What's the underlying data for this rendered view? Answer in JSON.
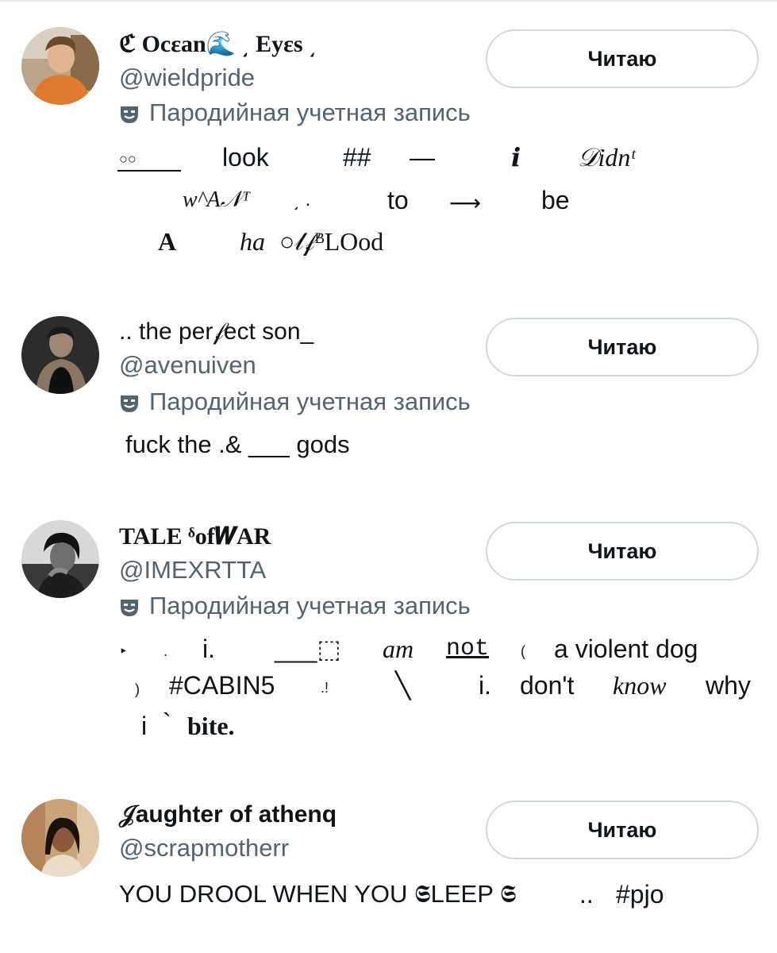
{
  "follow_label": "Читаю",
  "parody_label": "Пародийная учетная запись",
  "accounts": [
    {
      "name": "ℭ Ocεan🌊 ͵ Eyεs ͵",
      "handle": "@wieldpride",
      "bio": [
        "○○",
        "look",
        "##",
        "—",
        "𝒊",
        "𝒟idnᵗ",
        "w^A𝒩ᵀ",
        "͵ .",
        "to",
        "⟶",
        "be",
        "A",
        "ha",
        "○𝓁𝒻ᴮLOod"
      ]
    },
    {
      "name": ".. the per𝒻ect son_",
      "handle": "@avenuiven",
      "bio": [
        "fuck the .& ___ gods"
      ]
    },
    {
      "name": "TALE   ᵟof𝑾AR",
      "handle": "@IMEXRTTA",
      "bio": [
        "‣",
        ".",
        "i.",
        "___⬚",
        "am",
        "not",
        "(",
        "a violent dog",
        ")",
        "#CABIN5",
        ".!",
        "╲",
        "i.",
        "don't",
        "know",
        "why",
        "i",
        "`",
        "bite."
      ]
    },
    {
      "name": "𝒥aughter of athenq",
      "handle": "@scrapmotherr",
      "bio": [
        "YOU DROOL WHEN YOU 𝕾LEEP 𝕾",
        "..",
        "#pjo"
      ]
    }
  ]
}
